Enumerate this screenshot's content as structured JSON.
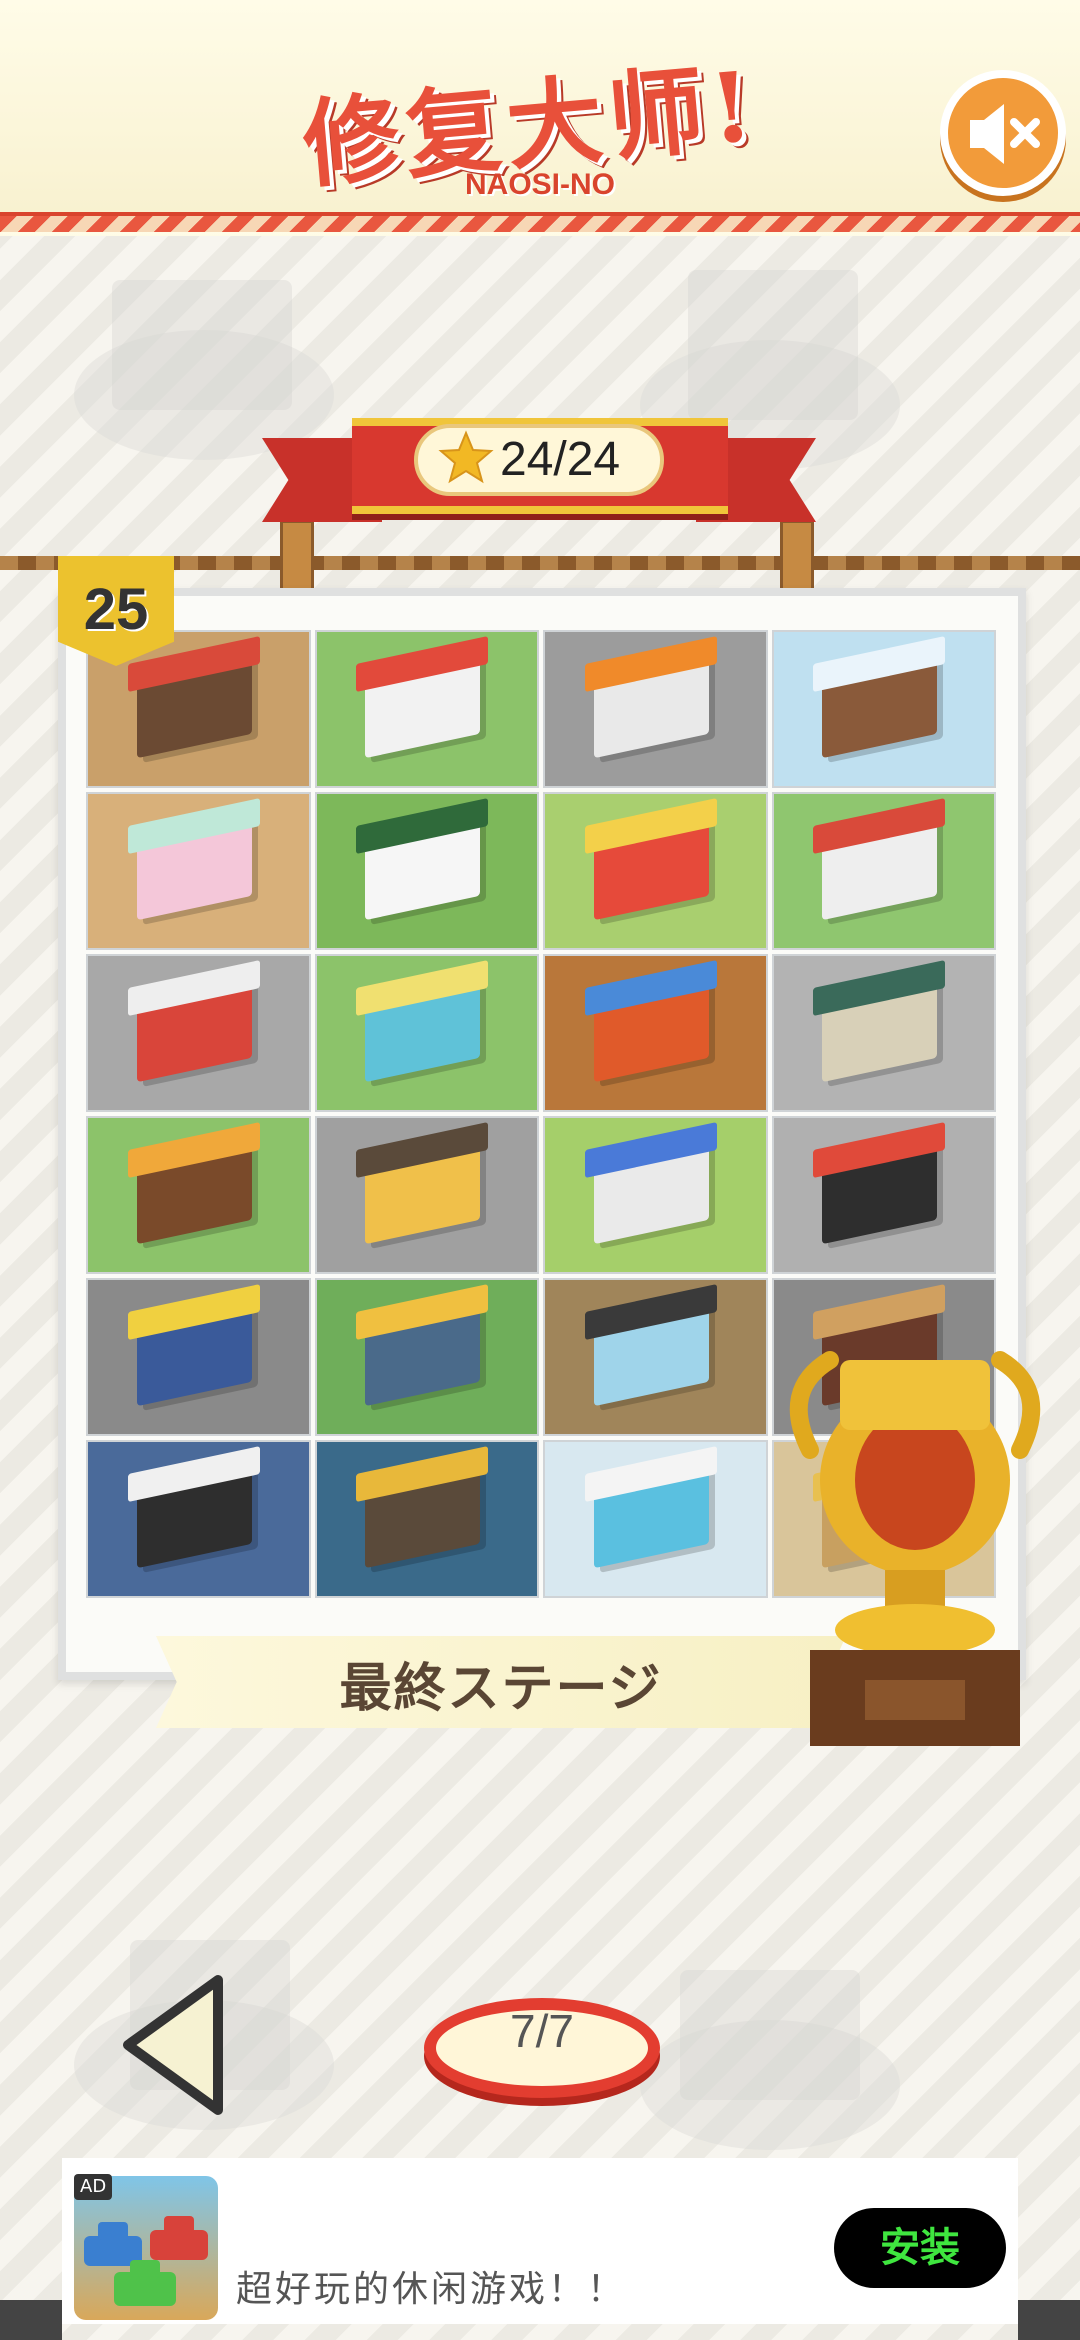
{
  "header": {
    "title": "修复大师!",
    "subtitle": "NAOSI-NO",
    "sound_icon": "speaker-muted-icon"
  },
  "progress": {
    "stars": "24/24",
    "star_icon": "star-icon"
  },
  "level": {
    "number": "25",
    "stage_label": "最終ステージ"
  },
  "tiles": [
    {
      "name": "coffee-shop",
      "ground": "#c9a06a",
      "body": "#6b4a33",
      "roof": "#d94a3a"
    },
    {
      "name": "burger-shop",
      "ground": "#8cc36a",
      "body": "#f2f2f2",
      "roof": "#e24a3b"
    },
    {
      "name": "gas-station",
      "ground": "#9c9c9c",
      "body": "#e9e9e9",
      "roof": "#f08a2a"
    },
    {
      "name": "winter-cabin",
      "ground": "#bfe0f0",
      "body": "#8a5a3a",
      "roof": "#eaf4fb"
    },
    {
      "name": "claw-arcade",
      "ground": "#d8b07a",
      "body": "#f4c7d9",
      "roof": "#bfe8d8"
    },
    {
      "name": "flower-shop",
      "ground": "#7db85a",
      "body": "#f6f6f6",
      "roof": "#2f6a3a"
    },
    {
      "name": "circus-tent",
      "ground": "#a9cf6f",
      "body": "#e64a3a",
      "roof": "#f3d04a"
    },
    {
      "name": "ice-cream-shop",
      "ground": "#8fc66f",
      "body": "#eeeeee",
      "roof": "#d94a3a"
    },
    {
      "name": "post-office",
      "ground": "#a8a8a8",
      "body": "#d9453a",
      "roof": "#eeeeee"
    },
    {
      "name": "power-station",
      "ground": "#8cc36a",
      "body": "#5fc2d8",
      "roof": "#f0e070"
    },
    {
      "name": "night-market",
      "ground": "#b9773a",
      "body": "#e05a2a",
      "roof": "#4a8ad8"
    },
    {
      "name": "convenience-store",
      "ground": "#b3b3b3",
      "body": "#d8d0b8",
      "roof": "#3a6a5a"
    },
    {
      "name": "log-house",
      "ground": "#8cc36a",
      "body": "#7a4a2a",
      "roof": "#f0a83a"
    },
    {
      "name": "curry-shop",
      "ground": "#a0a0a0",
      "body": "#f0c04a",
      "roof": "#5a4a3a"
    },
    {
      "name": "bakery",
      "ground": "#a5cf6a",
      "body": "#eaeaea",
      "roof": "#4a7ad8"
    },
    {
      "name": "pizza-bar",
      "ground": "#b0b0b0",
      "body": "#2e2e2e",
      "roof": "#e04a3a"
    },
    {
      "name": "police-station",
      "ground": "#8a8a8a",
      "body": "#3a5a9a",
      "roof": "#f0d040"
    },
    {
      "name": "japanese-cafe",
      "ground": "#6fae5a",
      "body": "#4a6a8a",
      "roof": "#f0c040"
    },
    {
      "name": "bank",
      "ground": "#a0855a",
      "body": "#9fd4ea",
      "roof": "#3a3a3a"
    },
    {
      "name": "steakhouse",
      "ground": "#8a8a8a",
      "body": "#6a3a2a",
      "roof": "#d0a060"
    },
    {
      "name": "cinema",
      "ground": "#4a6a9a",
      "body": "#2e2e2e",
      "roof": "#f0f0f0"
    },
    {
      "name": "record-shop",
      "ground": "#3a6a8a",
      "body": "#5a4a3a",
      "roof": "#e8b83a"
    },
    {
      "name": "pool-park",
      "ground": "#d8e8f0",
      "body": "#5ac0e0",
      "roof": "#f4f4f4"
    },
    {
      "name": "trophy-slot",
      "ground": "#d9c59a",
      "body": "#c8a060",
      "roof": "#e8c050"
    }
  ],
  "navigation": {
    "page": "7/7",
    "prev_icon": "triangle-left-icon"
  },
  "ad": {
    "badge": "AD",
    "text": "超好玩的休闲游戏！！",
    "install_label": "安装"
  },
  "colors": {
    "accent_red": "#e33d30",
    "gold": "#ecc22e",
    "install_green": "#3fe63f"
  }
}
